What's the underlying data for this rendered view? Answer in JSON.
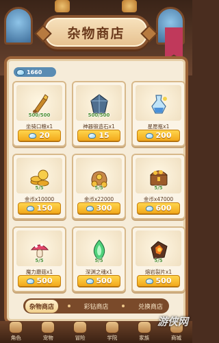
{
  "title": "杂物商店",
  "currency": {
    "icon": "diamond-icon",
    "value": "1660"
  },
  "items": [
    {
      "name": "坐骑口粮x1",
      "stock": "500/500",
      "price": "20",
      "icon": "horn-icon"
    },
    {
      "name": "神器锻造石x1",
      "stock": "500/500",
      "price": "15",
      "icon": "forge-stone-icon"
    },
    {
      "name": "星愿瓶x1",
      "stock": "",
      "price": "200",
      "icon": "wish-bottle-icon"
    },
    {
      "name": "金币x10000",
      "stock": "5/5",
      "price": "150",
      "icon": "coin-stack-icon"
    },
    {
      "name": "金币x22000",
      "stock": "5/5",
      "price": "300",
      "icon": "coin-bag-icon"
    },
    {
      "name": "金币x47000",
      "stock": "5/5",
      "price": "600",
      "icon": "treasure-chest-icon"
    },
    {
      "name": "魔力蘑菇x1",
      "stock": "5/5",
      "price": "500",
      "icon": "mushroom-icon"
    },
    {
      "name": "深渊之魂x1",
      "stock": "5/5",
      "price": "500",
      "icon": "abyss-soul-icon"
    },
    {
      "name": "熔岩裂片x1",
      "stock": "5/5",
      "price": "500",
      "icon": "lava-shard-icon"
    }
  ],
  "shop_tabs": [
    {
      "label": "杂物商店",
      "active": true
    },
    {
      "label": "彩钻商店",
      "active": false
    },
    {
      "label": "兑换商店",
      "active": false
    }
  ],
  "nav": [
    {
      "label": "角色",
      "icon": "character-icon"
    },
    {
      "label": "宠物",
      "icon": "pet-icon"
    },
    {
      "label": "冒险",
      "icon": "adventure-icon"
    },
    {
      "label": "学院",
      "icon": "academy-icon"
    },
    {
      "label": "家族",
      "icon": "family-icon"
    },
    {
      "label": "商城",
      "icon": "store-icon"
    }
  ],
  "watermark": "游侠网",
  "colors": {
    "accent": "#f2a81b",
    "panel": "#f6ecd9",
    "frame": "#9b6237",
    "stock": "#4c8f33"
  }
}
